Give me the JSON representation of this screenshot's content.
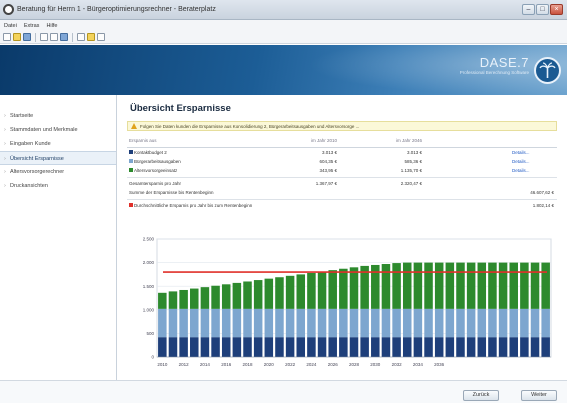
{
  "window": {
    "title": "Beratung für Herrn 1 - Bürgeroptimierungsrechner - Beraterplatz"
  },
  "menu": {
    "items": [
      "Datei",
      "Extras",
      "Hilfe"
    ]
  },
  "toolbar": {
    "icons": [
      "new-icon",
      "open-icon",
      "save-icon",
      "print-icon",
      "preview-icon",
      "export-icon",
      "filter-icon",
      "calculator-icon",
      "info-icon"
    ]
  },
  "brand": {
    "name": "DASE.7",
    "tagline": "Professional Berechnung Software"
  },
  "sidebar": {
    "items": [
      {
        "label": "Startseite",
        "active": false
      },
      {
        "label": "Stammdaten und Merkmale",
        "active": false
      },
      {
        "label": "Eingaben Kunde",
        "active": false
      },
      {
        "label": "Übersicht Ersparnisse",
        "active": true
      },
      {
        "label": "Altersvorsorgerechner",
        "active": false
      },
      {
        "label": "Druckansichten",
        "active": false
      }
    ]
  },
  "main": {
    "title": "Übersicht Ersparnisse",
    "info": "Folgen Sie Daten kunden die Ersparnisse aus Konsolidierung 2, Bürgerarbeitsausgaben und Altersvorsorge ..."
  },
  "table": {
    "headers": [
      "Ersparnis aus",
      "im Jahr 2010",
      "im Jahr 2046",
      ""
    ],
    "rows": [
      {
        "label": "Kontaktbudget 2",
        "v1": "3.013 €",
        "v2": "3.013 €",
        "link": "Details...",
        "color": "#1e3f7a"
      },
      {
        "label": "Bürgerarbeitsausgaben",
        "v1": "604,35 €",
        "v2": "585,36 €",
        "link": "Details...",
        "color": "#7da6cf"
      },
      {
        "label": "Altersvorsorgeeinsatz",
        "v1": "343,95 €",
        "v2": "1.135,70 €",
        "link": "Details...",
        "color": "#2d8a2d"
      }
    ],
    "totals": [
      {
        "label": "Gesamtersparnis pro Jahr",
        "v1": "1.367,97 €",
        "v2": "2.320,47 €",
        "v3": ""
      },
      {
        "label": "Summe der Ersparnisse bis Rentenbeginn",
        "v1": "",
        "v2": "",
        "v3": "46.607,62 €"
      }
    ],
    "average": {
      "label": "Durchschnittliche Ersparnis pro Jahr bis zum Rentenbeginn",
      "value": "1.802,14 €",
      "color": "#e0302a"
    }
  },
  "chart_data": {
    "type": "bar",
    "stacked": true,
    "categories": [
      "2010",
      "2011",
      "2012",
      "2013",
      "2014",
      "2015",
      "2016",
      "2017",
      "2018",
      "2019",
      "2020",
      "2021",
      "2022",
      "2023",
      "2024",
      "2025",
      "2026",
      "2027",
      "2028",
      "2029",
      "2030",
      "2031",
      "2032",
      "2033",
      "2034",
      "2035",
      "2036",
      "2037",
      "2038",
      "2039",
      "2040",
      "2041",
      "2042",
      "2043",
      "2044",
      "2045",
      "2046"
    ],
    "x_tick_labels": [
      "2010",
      "2012",
      "2014",
      "2016",
      "2018",
      "2020",
      "2022",
      "2024",
      "2026",
      "2028",
      "2030",
      "2032",
      "2034",
      "2036"
    ],
    "y_tick_labels": [
      "0",
      "500",
      "1.000",
      "1.500",
      "2.000",
      "2.500"
    ],
    "ylim": [
      0,
      2500
    ],
    "series": [
      {
        "name": "Kontaktbudget 2",
        "color": "#1e3f7a",
        "values": [
          420,
          420,
          420,
          420,
          420,
          420,
          420,
          420,
          420,
          420,
          420,
          420,
          420,
          420,
          420,
          420,
          420,
          420,
          420,
          420,
          420,
          420,
          420,
          420,
          420,
          420,
          420,
          420,
          420,
          420,
          420,
          420,
          420,
          420,
          420,
          420,
          420
        ]
      },
      {
        "name": "Bürgerarbeitsausgaben",
        "color": "#7da6cf",
        "values": [
          600,
          600,
          600,
          600,
          600,
          600,
          600,
          600,
          600,
          600,
          600,
          600,
          600,
          600,
          600,
          600,
          600,
          600,
          600,
          600,
          600,
          600,
          600,
          600,
          600,
          600,
          600,
          600,
          600,
          600,
          600,
          600,
          600,
          600,
          600,
          600,
          600
        ]
      },
      {
        "name": "Altersvorsorgeeinsatz",
        "color": "#2d8a2d",
        "values": [
          340,
          370,
          400,
          430,
          460,
          490,
          520,
          550,
          580,
          610,
          640,
          670,
          700,
          730,
          760,
          790,
          820,
          850,
          880,
          910,
          930,
          950,
          970,
          980,
          980,
          980,
          980,
          980,
          980,
          980,
          980,
          980,
          980,
          980,
          980,
          980,
          980
        ]
      }
    ],
    "reference_line": {
      "name": "Durchschnittliche Ersparnis",
      "value": 1800,
      "color": "#e0302a"
    }
  },
  "footer": {
    "back_label": "Zurück",
    "next_label": "Weiter"
  }
}
